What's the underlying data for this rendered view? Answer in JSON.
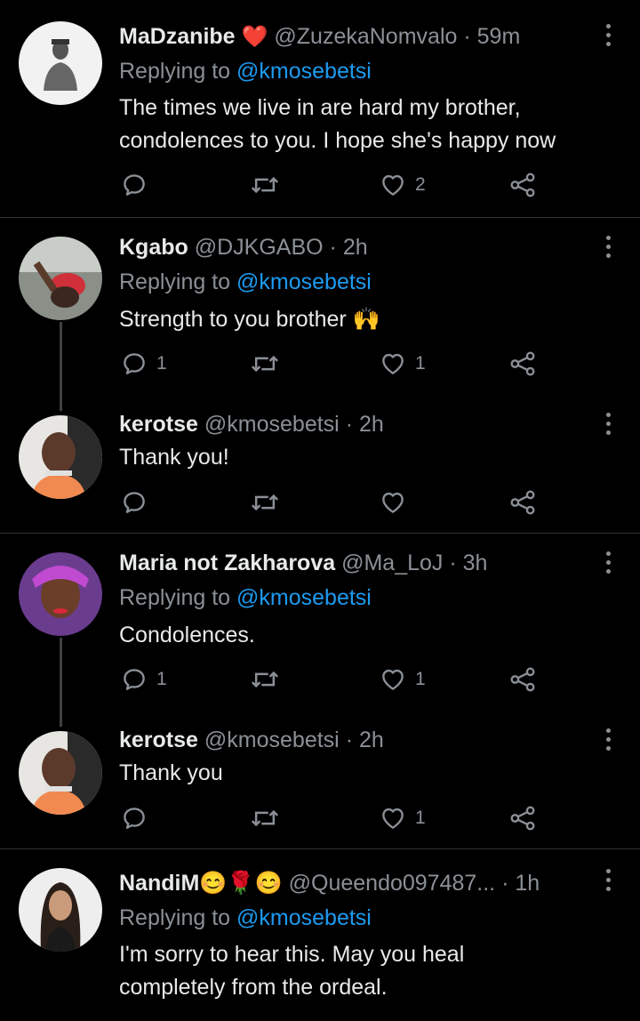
{
  "tweets": [
    {
      "name": "MaDzanibe",
      "name_emoji": "❤️",
      "handle": "@ZuzekaNomvalo",
      "sep": "·",
      "time": "59m",
      "replying_prefix": "Replying to",
      "replying_to": "@kmosebetsi",
      "lines": [
        "The times we live in are hard my brother,",
        "condolences to you. I hope she's happy now"
      ],
      "reply_count": "",
      "retweet_count": "",
      "like_count": "2",
      "avatar": "avatar-image"
    },
    {
      "name": "Kgabo",
      "handle": "@DJKGABO",
      "sep": "·",
      "time": "2h",
      "replying_prefix": "Replying to",
      "replying_to": "@kmosebetsi",
      "lines": [
        "Strength to you brother 🙌"
      ],
      "reply_count": "1",
      "retweet_count": "",
      "like_count": "1",
      "avatar": "avatar-image"
    },
    {
      "name": "kerotse",
      "handle": "@kmosebetsi",
      "sep": "·",
      "time": "2h",
      "lines": [
        "Thank you!"
      ],
      "reply_count": "",
      "retweet_count": "",
      "like_count": "",
      "avatar": "avatar-image"
    },
    {
      "name": "Maria not Zakharova",
      "handle": "@Ma_LoJ",
      "sep": "·",
      "time": "3h",
      "replying_prefix": "Replying to",
      "replying_to": "@kmosebetsi",
      "lines": [
        "Condolences."
      ],
      "reply_count": "1",
      "retweet_count": "",
      "like_count": "1",
      "avatar": "avatar-image"
    },
    {
      "name": "kerotse",
      "handle": "@kmosebetsi",
      "sep": "·",
      "time": "2h",
      "lines": [
        "Thank you"
      ],
      "reply_count": "",
      "retweet_count": "",
      "like_count": "1",
      "avatar": "avatar-image"
    },
    {
      "name": "NandiM",
      "name_emoji": "😊🌹😊",
      "handle": "@Queendo097487...",
      "sep": "·",
      "time": "1h",
      "replying_prefix": "Replying to",
      "replying_to": "@kmosebetsi",
      "lines": [
        "I'm sorry to hear this. May you heal",
        "completely from the ordeal."
      ],
      "avatar": "avatar-image"
    }
  ],
  "icons": {
    "reply": "reply-icon",
    "retweet": "retweet-icon",
    "like": "heart-icon",
    "share": "share-icon",
    "more": "more-options-icon"
  },
  "colors": {
    "background": "#000000",
    "text": "#e7e9ea",
    "muted": "#8b9096",
    "mention": "#1d9bf0",
    "heart": "#e0245e",
    "divider": "#2f3336"
  }
}
